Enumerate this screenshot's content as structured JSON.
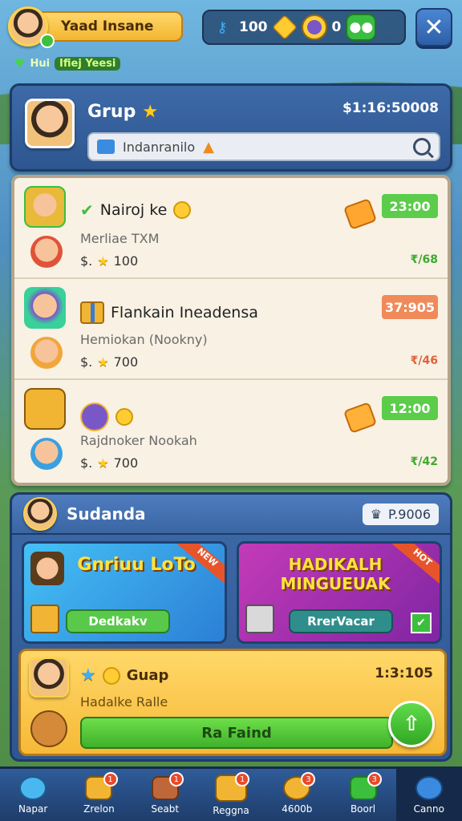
{
  "player": {
    "name": "Yaad Insane"
  },
  "status": {
    "left": "Hui",
    "tag": "Ifiej Yeesi"
  },
  "currency": {
    "keys": "100",
    "chats": "0"
  },
  "group": {
    "title": "Grup",
    "balance": "$1:16:50008",
    "search_value": "Indanranilo"
  },
  "offers": [
    {
      "title": "Nairoj ke",
      "subtitle": "Merliae TXM",
      "cost_prefix": "$.",
      "cost": "100",
      "price": "23:00",
      "price_color": "green",
      "ratio": "₹/68",
      "ratio_color": "green"
    },
    {
      "title": "Flankain Ineadensa",
      "subtitle": "Hemiokan (Nookny)",
      "cost_prefix": "$.",
      "cost": "700",
      "price": "37:905",
      "price_color": "orange",
      "ratio": "₹/46",
      "ratio_color": "orange"
    },
    {
      "title": "",
      "subtitle": "Rajdnoker Nookah",
      "cost_prefix": "$.",
      "cost": "700",
      "price": "12:00",
      "price_color": "green",
      "ratio": "₹/42",
      "ratio_color": "green"
    }
  ],
  "squad": {
    "title": "Sudanda",
    "count": "P.9006"
  },
  "promos": [
    {
      "headline": "Gnriuu LoTo",
      "ribbon": "NEW",
      "cta": "Dedkakv"
    },
    {
      "headline": "HADIKALH MINGUEUAK",
      "ribbon": "HOT",
      "cta": "RrerVacar"
    }
  ],
  "quest": {
    "title": "Guap",
    "time": "1:3:105",
    "subtitle": "Hadalke Ralle",
    "button": "Ra Faind"
  },
  "nav": [
    {
      "label": "Napar",
      "badge": ""
    },
    {
      "label": "Zrelon",
      "badge": "1"
    },
    {
      "label": "Seabt",
      "badge": "1"
    },
    {
      "label": "Reggna",
      "badge": "1"
    },
    {
      "label": "4600b",
      "badge": "3"
    },
    {
      "label": "Boorl",
      "badge": "3"
    },
    {
      "label": "Canno",
      "badge": ""
    }
  ]
}
